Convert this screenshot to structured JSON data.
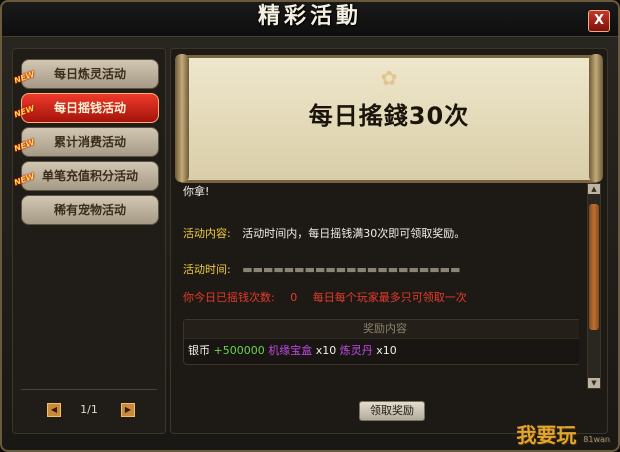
{
  "window": {
    "title": "精彩活動",
    "close_label": "X"
  },
  "sidebar": {
    "tabs": [
      {
        "label": "每日炼灵活动",
        "badge": "NEW"
      },
      {
        "label": "每日摇钱活动",
        "badge": "NEW",
        "active": true
      },
      {
        "label": "累计消费活动",
        "badge": "NEW"
      },
      {
        "label": "单笔充值积分活动",
        "badge": "NEW"
      },
      {
        "label": "稀有宠物活动",
        "badge": ""
      }
    ],
    "pager": {
      "text": "1/1",
      "prev_icon": "◀",
      "next_icon": "▶"
    }
  },
  "banner": {
    "title": "每日搖錢30次"
  },
  "content": {
    "intro": "你拿!",
    "desc_label": "活动内容:",
    "desc_value": "活动时间内，每日摇钱满30次即可领取奖励。",
    "time_label": "活动时间:",
    "count_label": "你今日已摇钱次数:",
    "count_value": "0",
    "limit_note": "每日每个玩家最多只可领取一次"
  },
  "reward": {
    "header": "奖励内容",
    "items": [
      {
        "name": "银币",
        "amount": "+500000",
        "name_color": "silver"
      },
      {
        "name": "机缘宝盒",
        "amount": "x10",
        "name_color": "purple"
      },
      {
        "name": "炼灵丹",
        "amount": "x10",
        "name_color": "purple"
      }
    ]
  },
  "buttons": {
    "claim": "领取奖励"
  },
  "watermark": {
    "text": "我要玩",
    "sub": "81wan"
  }
}
